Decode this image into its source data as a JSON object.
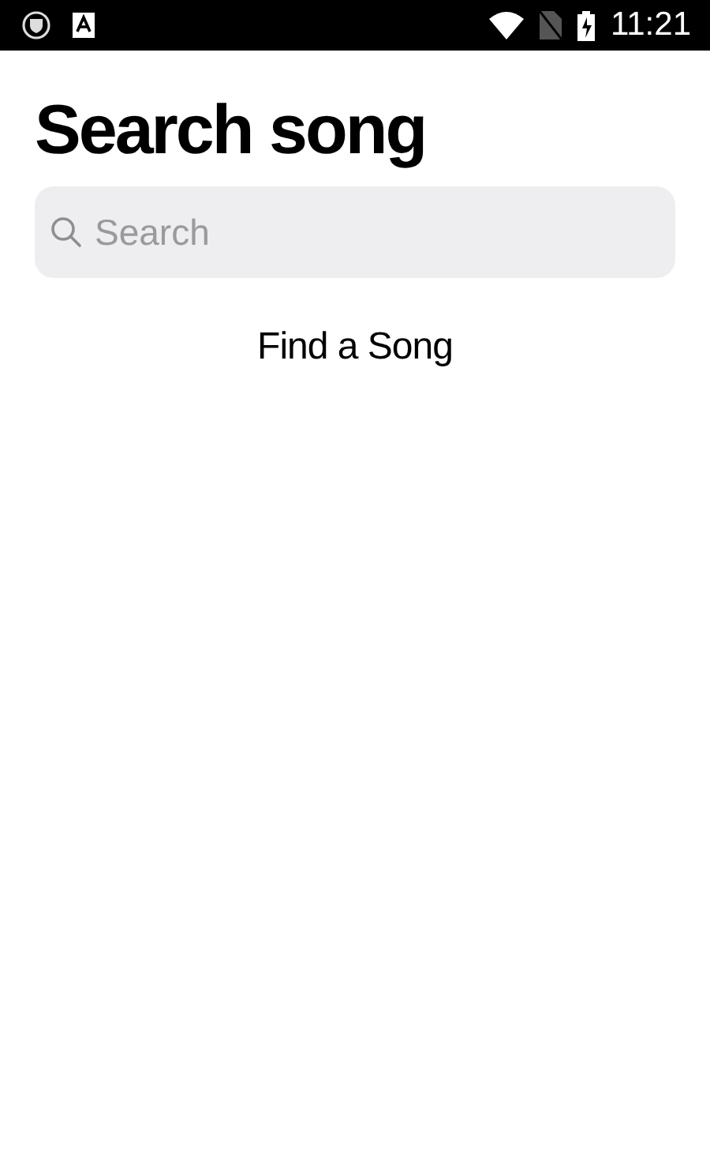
{
  "status_bar": {
    "time": "11:21"
  },
  "title": "Search song",
  "search": {
    "placeholder": "Search"
  },
  "message": "Find a Song"
}
